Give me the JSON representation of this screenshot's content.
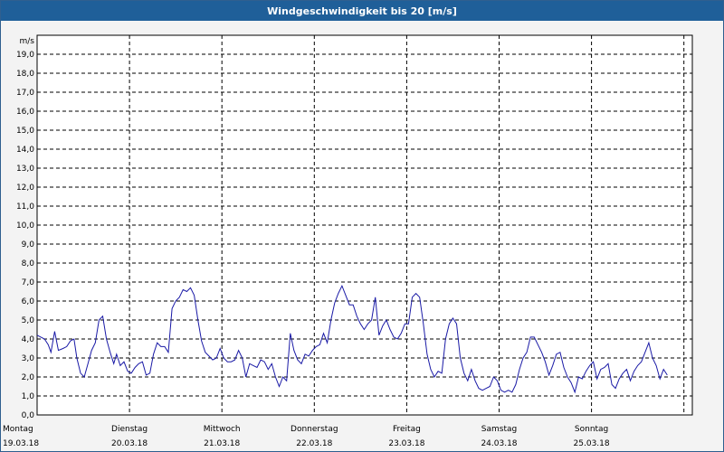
{
  "window": {
    "title": "Windgeschwindigkeit bis 20 [m/s]"
  },
  "chart_data": {
    "type": "line",
    "title": "Windgeschwindigkeit bis 20 [m/s]",
    "ylabel": "m/s",
    "ylim": [
      0,
      20
    ],
    "grid": true,
    "y_ticks": [
      "0,0",
      "1,0",
      "2,0",
      "3,0",
      "4,0",
      "5,0",
      "6,0",
      "7,0",
      "8,0",
      "9,0",
      "10,0",
      "11,0",
      "12,0",
      "13,0",
      "14,0",
      "15,0",
      "16,0",
      "17,0",
      "18,0",
      "19,0"
    ],
    "x_days": [
      {
        "day": "Montag",
        "date": "19.03.18"
      },
      {
        "day": "Dienstag",
        "date": "20.03.18"
      },
      {
        "day": "Mittwoch",
        "date": "21.03.18"
      },
      {
        "day": "Donnerstag",
        "date": "22.03.18"
      },
      {
        "day": "Freitag",
        "date": "23.03.18"
      },
      {
        "day": "Samstag",
        "date": "24.03.18"
      },
      {
        "day": "Sonntag",
        "date": "25.03.18"
      }
    ],
    "xlim_days": [
      0,
      7
    ],
    "series": [
      {
        "color": "#1a1aa6",
        "points": [
          [
            0.0,
            4.2
          ],
          [
            0.04,
            4.1
          ],
          [
            0.08,
            4.0
          ],
          [
            0.12,
            3.7
          ],
          [
            0.15,
            3.3
          ],
          [
            0.19,
            4.4
          ],
          [
            0.23,
            3.4
          ],
          [
            0.28,
            3.5
          ],
          [
            0.32,
            3.6
          ],
          [
            0.36,
            3.9
          ],
          [
            0.4,
            4.0
          ],
          [
            0.43,
            3.0
          ],
          [
            0.47,
            2.2
          ],
          [
            0.51,
            2.0
          ],
          [
            0.55,
            2.7
          ],
          [
            0.59,
            3.4
          ],
          [
            0.63,
            3.8
          ],
          [
            0.67,
            5.0
          ],
          [
            0.71,
            5.2
          ],
          [
            0.75,
            4.0
          ],
          [
            0.79,
            3.3
          ],
          [
            0.83,
            2.7
          ],
          [
            0.86,
            3.2
          ],
          [
            0.9,
            2.6
          ],
          [
            0.94,
            2.8
          ],
          [
            0.98,
            2.3
          ],
          [
            1.02,
            2.2
          ],
          [
            1.06,
            2.5
          ],
          [
            1.1,
            2.7
          ],
          [
            1.14,
            2.8
          ],
          [
            1.18,
            2.1
          ],
          [
            1.22,
            2.2
          ],
          [
            1.26,
            3.2
          ],
          [
            1.3,
            3.8
          ],
          [
            1.34,
            3.6
          ],
          [
            1.38,
            3.6
          ],
          [
            1.42,
            3.3
          ],
          [
            1.46,
            5.6
          ],
          [
            1.5,
            6.0
          ],
          [
            1.54,
            6.2
          ],
          [
            1.58,
            6.6
          ],
          [
            1.62,
            6.5
          ],
          [
            1.66,
            6.7
          ],
          [
            1.7,
            6.3
          ],
          [
            1.74,
            5.0
          ],
          [
            1.78,
            3.9
          ],
          [
            1.82,
            3.3
          ],
          [
            1.86,
            3.1
          ],
          [
            1.9,
            2.9
          ],
          [
            1.94,
            3.0
          ],
          [
            1.98,
            3.5
          ],
          [
            2.02,
            3.0
          ],
          [
            2.06,
            2.8
          ],
          [
            2.1,
            2.8
          ],
          [
            2.14,
            2.9
          ],
          [
            2.18,
            3.4
          ],
          [
            2.22,
            3.0
          ],
          [
            2.26,
            2.0
          ],
          [
            2.3,
            2.7
          ],
          [
            2.34,
            2.6
          ],
          [
            2.38,
            2.5
          ],
          [
            2.42,
            2.9
          ],
          [
            2.46,
            2.8
          ],
          [
            2.5,
            2.4
          ],
          [
            2.54,
            2.7
          ],
          [
            2.58,
            2.0
          ],
          [
            2.62,
            1.5
          ],
          [
            2.66,
            2.0
          ],
          [
            2.7,
            1.8
          ],
          [
            2.74,
            4.3
          ],
          [
            2.78,
            3.4
          ],
          [
            2.82,
            2.9
          ],
          [
            2.86,
            2.7
          ],
          [
            2.9,
            3.2
          ],
          [
            2.94,
            3.1
          ],
          [
            2.98,
            3.4
          ],
          [
            3.02,
            3.6
          ],
          [
            3.06,
            3.7
          ],
          [
            3.1,
            4.3
          ],
          [
            3.14,
            3.8
          ],
          [
            3.18,
            5.0
          ],
          [
            3.22,
            5.9
          ],
          [
            3.26,
            6.4
          ],
          [
            3.3,
            6.8
          ],
          [
            3.34,
            6.3
          ],
          [
            3.38,
            5.8
          ],
          [
            3.42,
            5.8
          ],
          [
            3.46,
            5.2
          ],
          [
            3.5,
            4.8
          ],
          [
            3.54,
            4.5
          ],
          [
            3.58,
            4.8
          ],
          [
            3.62,
            5.0
          ],
          [
            3.66,
            6.2
          ],
          [
            3.7,
            4.2
          ],
          [
            3.74,
            4.7
          ],
          [
            3.78,
            5.0
          ],
          [
            3.82,
            4.5
          ],
          [
            3.86,
            4.1
          ],
          [
            3.9,
            4.0
          ],
          [
            3.94,
            4.3
          ],
          [
            3.98,
            4.8
          ],
          [
            4.02,
            4.8
          ],
          [
            4.06,
            6.2
          ],
          [
            4.1,
            6.4
          ],
          [
            4.14,
            6.2
          ],
          [
            4.18,
            4.8
          ],
          [
            4.22,
            3.2
          ],
          [
            4.26,
            2.4
          ],
          [
            4.3,
            2.0
          ],
          [
            4.34,
            2.3
          ],
          [
            4.38,
            2.2
          ],
          [
            4.42,
            4.0
          ],
          [
            4.46,
            4.8
          ],
          [
            4.5,
            5.1
          ],
          [
            4.54,
            4.8
          ],
          [
            4.58,
            3.0
          ],
          [
            4.62,
            2.2
          ],
          [
            4.66,
            1.8
          ],
          [
            4.7,
            2.4
          ],
          [
            4.74,
            1.8
          ],
          [
            4.78,
            1.4
          ],
          [
            4.82,
            1.3
          ],
          [
            4.86,
            1.4
          ],
          [
            4.9,
            1.5
          ],
          [
            4.94,
            2.0
          ],
          [
            4.98,
            1.8
          ],
          [
            5.02,
            1.3
          ],
          [
            5.06,
            1.2
          ],
          [
            5.1,
            1.3
          ],
          [
            5.14,
            1.2
          ],
          [
            5.18,
            1.6
          ],
          [
            5.22,
            2.4
          ],
          [
            5.26,
            3.0
          ],
          [
            5.3,
            3.3
          ],
          [
            5.34,
            4.1
          ],
          [
            5.38,
            4.1
          ],
          [
            5.42,
            3.7
          ],
          [
            5.46,
            3.3
          ],
          [
            5.5,
            2.8
          ],
          [
            5.54,
            2.1
          ],
          [
            5.58,
            2.6
          ],
          [
            5.62,
            3.2
          ],
          [
            5.66,
            3.3
          ],
          [
            5.7,
            2.5
          ],
          [
            5.74,
            2.0
          ],
          [
            5.78,
            1.7
          ],
          [
            5.82,
            1.2
          ],
          [
            5.86,
            2.0
          ],
          [
            5.9,
            1.9
          ],
          [
            5.94,
            2.3
          ],
          [
            5.98,
            2.6
          ],
          [
            6.02,
            2.8
          ],
          [
            6.06,
            1.9
          ],
          [
            6.1,
            2.4
          ],
          [
            6.14,
            2.5
          ],
          [
            6.18,
            2.7
          ],
          [
            6.22,
            1.6
          ],
          [
            6.26,
            1.4
          ],
          [
            6.3,
            1.9
          ],
          [
            6.34,
            2.2
          ],
          [
            6.38,
            2.4
          ],
          [
            6.42,
            1.8
          ],
          [
            6.46,
            2.3
          ],
          [
            6.5,
            2.6
          ],
          [
            6.54,
            2.8
          ],
          [
            6.58,
            3.3
          ],
          [
            6.62,
            3.8
          ],
          [
            6.66,
            3.0
          ],
          [
            6.7,
            2.6
          ],
          [
            6.74,
            1.9
          ],
          [
            6.78,
            2.4
          ],
          [
            6.82,
            2.1
          ]
        ]
      }
    ]
  }
}
